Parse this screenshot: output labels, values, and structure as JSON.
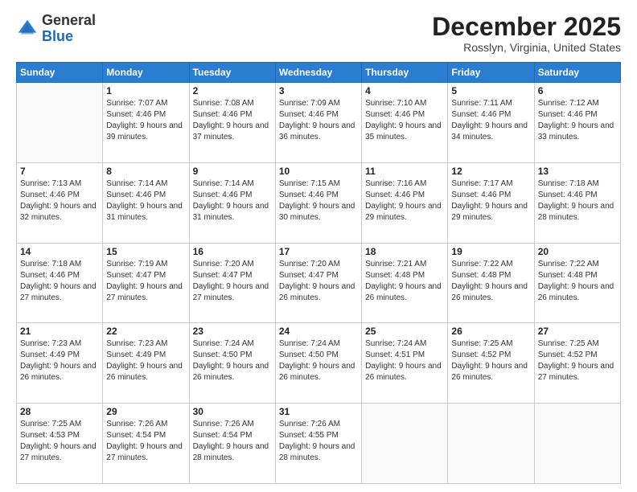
{
  "logo": {
    "general": "General",
    "blue": "Blue"
  },
  "header": {
    "month": "December 2025",
    "location": "Rosslyn, Virginia, United States"
  },
  "days_of_week": [
    "Sunday",
    "Monday",
    "Tuesday",
    "Wednesday",
    "Thursday",
    "Friday",
    "Saturday"
  ],
  "weeks": [
    [
      {
        "day": "",
        "sunrise": "",
        "sunset": "",
        "daylight": ""
      },
      {
        "day": "1",
        "sunrise": "Sunrise: 7:07 AM",
        "sunset": "Sunset: 4:46 PM",
        "daylight": "Daylight: 9 hours and 39 minutes."
      },
      {
        "day": "2",
        "sunrise": "Sunrise: 7:08 AM",
        "sunset": "Sunset: 4:46 PM",
        "daylight": "Daylight: 9 hours and 37 minutes."
      },
      {
        "day": "3",
        "sunrise": "Sunrise: 7:09 AM",
        "sunset": "Sunset: 4:46 PM",
        "daylight": "Daylight: 9 hours and 36 minutes."
      },
      {
        "day": "4",
        "sunrise": "Sunrise: 7:10 AM",
        "sunset": "Sunset: 4:46 PM",
        "daylight": "Daylight: 9 hours and 35 minutes."
      },
      {
        "day": "5",
        "sunrise": "Sunrise: 7:11 AM",
        "sunset": "Sunset: 4:46 PM",
        "daylight": "Daylight: 9 hours and 34 minutes."
      },
      {
        "day": "6",
        "sunrise": "Sunrise: 7:12 AM",
        "sunset": "Sunset: 4:46 PM",
        "daylight": "Daylight: 9 hours and 33 minutes."
      }
    ],
    [
      {
        "day": "7",
        "sunrise": "Sunrise: 7:13 AM",
        "sunset": "Sunset: 4:46 PM",
        "daylight": "Daylight: 9 hours and 32 minutes."
      },
      {
        "day": "8",
        "sunrise": "Sunrise: 7:14 AM",
        "sunset": "Sunset: 4:46 PM",
        "daylight": "Daylight: 9 hours and 31 minutes."
      },
      {
        "day": "9",
        "sunrise": "Sunrise: 7:14 AM",
        "sunset": "Sunset: 4:46 PM",
        "daylight": "Daylight: 9 hours and 31 minutes."
      },
      {
        "day": "10",
        "sunrise": "Sunrise: 7:15 AM",
        "sunset": "Sunset: 4:46 PM",
        "daylight": "Daylight: 9 hours and 30 minutes."
      },
      {
        "day": "11",
        "sunrise": "Sunrise: 7:16 AM",
        "sunset": "Sunset: 4:46 PM",
        "daylight": "Daylight: 9 hours and 29 minutes."
      },
      {
        "day": "12",
        "sunrise": "Sunrise: 7:17 AM",
        "sunset": "Sunset: 4:46 PM",
        "daylight": "Daylight: 9 hours and 29 minutes."
      },
      {
        "day": "13",
        "sunrise": "Sunrise: 7:18 AM",
        "sunset": "Sunset: 4:46 PM",
        "daylight": "Daylight: 9 hours and 28 minutes."
      }
    ],
    [
      {
        "day": "14",
        "sunrise": "Sunrise: 7:18 AM",
        "sunset": "Sunset: 4:46 PM",
        "daylight": "Daylight: 9 hours and 27 minutes."
      },
      {
        "day": "15",
        "sunrise": "Sunrise: 7:19 AM",
        "sunset": "Sunset: 4:47 PM",
        "daylight": "Daylight: 9 hours and 27 minutes."
      },
      {
        "day": "16",
        "sunrise": "Sunrise: 7:20 AM",
        "sunset": "Sunset: 4:47 PM",
        "daylight": "Daylight: 9 hours and 27 minutes."
      },
      {
        "day": "17",
        "sunrise": "Sunrise: 7:20 AM",
        "sunset": "Sunset: 4:47 PM",
        "daylight": "Daylight: 9 hours and 26 minutes."
      },
      {
        "day": "18",
        "sunrise": "Sunrise: 7:21 AM",
        "sunset": "Sunset: 4:48 PM",
        "daylight": "Daylight: 9 hours and 26 minutes."
      },
      {
        "day": "19",
        "sunrise": "Sunrise: 7:22 AM",
        "sunset": "Sunset: 4:48 PM",
        "daylight": "Daylight: 9 hours and 26 minutes."
      },
      {
        "day": "20",
        "sunrise": "Sunrise: 7:22 AM",
        "sunset": "Sunset: 4:48 PM",
        "daylight": "Daylight: 9 hours and 26 minutes."
      }
    ],
    [
      {
        "day": "21",
        "sunrise": "Sunrise: 7:23 AM",
        "sunset": "Sunset: 4:49 PM",
        "daylight": "Daylight: 9 hours and 26 minutes."
      },
      {
        "day": "22",
        "sunrise": "Sunrise: 7:23 AM",
        "sunset": "Sunset: 4:49 PM",
        "daylight": "Daylight: 9 hours and 26 minutes."
      },
      {
        "day": "23",
        "sunrise": "Sunrise: 7:24 AM",
        "sunset": "Sunset: 4:50 PM",
        "daylight": "Daylight: 9 hours and 26 minutes."
      },
      {
        "day": "24",
        "sunrise": "Sunrise: 7:24 AM",
        "sunset": "Sunset: 4:50 PM",
        "daylight": "Daylight: 9 hours and 26 minutes."
      },
      {
        "day": "25",
        "sunrise": "Sunrise: 7:24 AM",
        "sunset": "Sunset: 4:51 PM",
        "daylight": "Daylight: 9 hours and 26 minutes."
      },
      {
        "day": "26",
        "sunrise": "Sunrise: 7:25 AM",
        "sunset": "Sunset: 4:52 PM",
        "daylight": "Daylight: 9 hours and 26 minutes."
      },
      {
        "day": "27",
        "sunrise": "Sunrise: 7:25 AM",
        "sunset": "Sunset: 4:52 PM",
        "daylight": "Daylight: 9 hours and 27 minutes."
      }
    ],
    [
      {
        "day": "28",
        "sunrise": "Sunrise: 7:25 AM",
        "sunset": "Sunset: 4:53 PM",
        "daylight": "Daylight: 9 hours and 27 minutes."
      },
      {
        "day": "29",
        "sunrise": "Sunrise: 7:26 AM",
        "sunset": "Sunset: 4:54 PM",
        "daylight": "Daylight: 9 hours and 27 minutes."
      },
      {
        "day": "30",
        "sunrise": "Sunrise: 7:26 AM",
        "sunset": "Sunset: 4:54 PM",
        "daylight": "Daylight: 9 hours and 28 minutes."
      },
      {
        "day": "31",
        "sunrise": "Sunrise: 7:26 AM",
        "sunset": "Sunset: 4:55 PM",
        "daylight": "Daylight: 9 hours and 28 minutes."
      },
      {
        "day": "",
        "sunrise": "",
        "sunset": "",
        "daylight": ""
      },
      {
        "day": "",
        "sunrise": "",
        "sunset": "",
        "daylight": ""
      },
      {
        "day": "",
        "sunrise": "",
        "sunset": "",
        "daylight": ""
      }
    ]
  ]
}
